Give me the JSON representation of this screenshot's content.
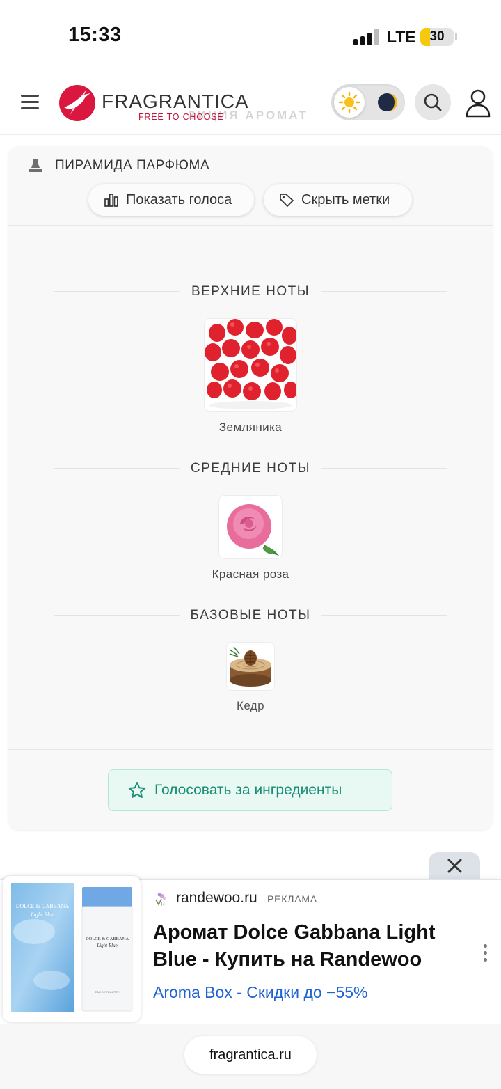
{
  "status_bar": {
    "time": "15:33",
    "network": "LTE",
    "battery_level": "30",
    "battery_fraction": 0.3
  },
  "header": {
    "logo_name": "FRAGRANTICA",
    "logo_tagline": "FREE TO CHOOSE",
    "ghost_title": "ЗИЦИЯ АРОМАТ",
    "icons": {
      "menu": "hamburger-menu-icon",
      "logo": "hummingbird-logo",
      "light_theme": "sun-icon",
      "dark_theme": "moon-icon",
      "search": "search-icon",
      "profile": "user-icon"
    }
  },
  "pyramid": {
    "title": "ПИРАМИДА ПАРФЮМА",
    "show_votes_label": "Показать голоса",
    "hide_tags_label": "Скрыть метки",
    "tiers": [
      {
        "label": "ВЕРХНИЕ НОТЫ",
        "notes": [
          {
            "name": "Земляника",
            "icon": "wild-strawberry-image"
          }
        ]
      },
      {
        "label": "СРЕДНИЕ НОТЫ",
        "notes": [
          {
            "name": "Красная роза",
            "icon": "rose-image"
          }
        ]
      },
      {
        "label": "БАЗОВЫЕ НОТЫ",
        "notes": [
          {
            "name": "Кедр",
            "icon": "cedar-wood-image"
          }
        ]
      }
    ],
    "vote_label": "Голосовать за ингредиенты"
  },
  "ad": {
    "domain": "randewoo.ru",
    "tag": "РЕКЛАМА",
    "title": "Аромат Dolce Gabbana Light Blue - Купить на Randewoo",
    "subtitle": "Aroma Box - Скидки до −55%",
    "product_brand": "DOLCE & GABBANA",
    "product_name": "Light Blue",
    "product_type": "EAU DE TOILETTE"
  },
  "browser": {
    "url": "fragrantica.ru"
  },
  "colors": {
    "brand_red": "#d9173f",
    "vote_green": "#1a8d74",
    "ad_link_blue": "#1f63d3",
    "battery_yellow": "#f6c90e"
  }
}
